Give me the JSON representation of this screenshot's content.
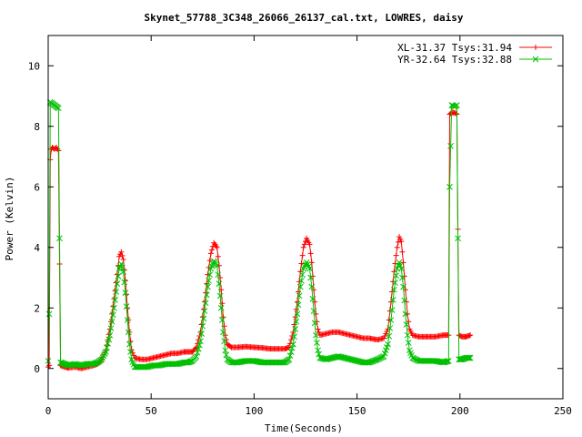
{
  "chart_data": {
    "type": "scatter",
    "title": "Skynet_57788_3C348_26066_26137_cal.txt, LOWRES, daisy",
    "xlabel": "Time(Seconds)",
    "ylabel": "Power (Kelvin)",
    "xlim": [
      0,
      250
    ],
    "ylim": [
      -1,
      11
    ],
    "x_ticks": [
      0,
      50,
      100,
      150,
      200,
      250
    ],
    "y_ticks": [
      0,
      2,
      4,
      6,
      8,
      10
    ],
    "grid": false,
    "legend_position": "top-right",
    "series": [
      {
        "name": "XL-31.37 Tsys:31.94",
        "color": "#ff0000",
        "marker": "plus",
        "points": [
          [
            0,
            0.05
          ],
          [
            0.5,
            0.1
          ],
          [
            1,
            6.9
          ],
          [
            1.5,
            7.25
          ],
          [
            2,
            7.3
          ],
          [
            3,
            7.25
          ],
          [
            4,
            7.3
          ],
          [
            5,
            7.2
          ],
          [
            5.5,
            3.45
          ],
          [
            6,
            0.1
          ],
          [
            8,
            0.05
          ],
          [
            10,
            0.02
          ],
          [
            13,
            0.05
          ],
          [
            16,
            0.0
          ],
          [
            19,
            0.05
          ],
          [
            22,
            0.1
          ],
          [
            24,
            0.15
          ],
          [
            26,
            0.3
          ],
          [
            28,
            0.6
          ],
          [
            30,
            1.3
          ],
          [
            32,
            2.3
          ],
          [
            33.5,
            3.1
          ],
          [
            34.5,
            3.7
          ],
          [
            35.5,
            3.85
          ],
          [
            36.5,
            3.6
          ],
          [
            37.5,
            2.9
          ],
          [
            38.5,
            2.0
          ],
          [
            39.5,
            1.2
          ],
          [
            40.5,
            0.6
          ],
          [
            42,
            0.35
          ],
          [
            45,
            0.3
          ],
          [
            48,
            0.3
          ],
          [
            51,
            0.35
          ],
          [
            54,
            0.4
          ],
          [
            57,
            0.45
          ],
          [
            60,
            0.5
          ],
          [
            63,
            0.5
          ],
          [
            66,
            0.55
          ],
          [
            68,
            0.55
          ],
          [
            70,
            0.55
          ],
          [
            72,
            0.7
          ],
          [
            74,
            1.2
          ],
          [
            76,
            2.2
          ],
          [
            77.5,
            3.1
          ],
          [
            79,
            3.8
          ],
          [
            80.5,
            4.15
          ],
          [
            82,
            4.0
          ],
          [
            83,
            3.4
          ],
          [
            84,
            2.6
          ],
          [
            85,
            1.7
          ],
          [
            86,
            1.1
          ],
          [
            87,
            0.8
          ],
          [
            89,
            0.7
          ],
          [
            92,
            0.7
          ],
          [
            96,
            0.72
          ],
          [
            100,
            0.7
          ],
          [
            104,
            0.68
          ],
          [
            108,
            0.65
          ],
          [
            112,
            0.65
          ],
          [
            115,
            0.65
          ],
          [
            117,
            0.7
          ],
          [
            119,
            1.2
          ],
          [
            121,
            2.2
          ],
          [
            122.5,
            3.2
          ],
          [
            124,
            4.0
          ],
          [
            125.5,
            4.3
          ],
          [
            127,
            4.1
          ],
          [
            128,
            3.5
          ],
          [
            129,
            2.6
          ],
          [
            130,
            1.8
          ],
          [
            131,
            1.3
          ],
          [
            132,
            1.1
          ],
          [
            135,
            1.15
          ],
          [
            138,
            1.2
          ],
          [
            141,
            1.2
          ],
          [
            144,
            1.15
          ],
          [
            147,
            1.1
          ],
          [
            150,
            1.05
          ],
          [
            153,
            1.0
          ],
          [
            156,
            1.0
          ],
          [
            160,
            0.95
          ],
          [
            163,
            1.0
          ],
          [
            165,
            1.3
          ],
          [
            166.5,
            2.2
          ],
          [
            168,
            3.2
          ],
          [
            169.5,
            4.0
          ],
          [
            170.5,
            4.35
          ],
          [
            171.5,
            4.2
          ],
          [
            172.5,
            3.5
          ],
          [
            173.5,
            2.6
          ],
          [
            174.5,
            1.8
          ],
          [
            175.5,
            1.3
          ],
          [
            177,
            1.1
          ],
          [
            180,
            1.05
          ],
          [
            184,
            1.05
          ],
          [
            188,
            1.05
          ],
          [
            192,
            1.1
          ],
          [
            194.5,
            1.1
          ],
          [
            195,
            8.4
          ],
          [
            196,
            8.45
          ],
          [
            197.5,
            8.45
          ],
          [
            198.5,
            8.4
          ],
          [
            199,
            4.6
          ],
          [
            199.5,
            1.1
          ],
          [
            201,
            1.05
          ],
          [
            203,
            1.05
          ],
          [
            205,
            1.1
          ]
        ]
      },
      {
        "name": "YR-32.64 Tsys:32.88",
        "color": "#00c000",
        "marker": "cross",
        "points": [
          [
            0,
            0.25
          ],
          [
            0.5,
            1.8
          ],
          [
            1,
            8.8
          ],
          [
            2,
            8.75
          ],
          [
            3,
            8.7
          ],
          [
            4,
            8.65
          ],
          [
            5,
            8.6
          ],
          [
            5.5,
            4.3
          ],
          [
            6,
            0.2
          ],
          [
            8,
            0.15
          ],
          [
            10,
            0.1
          ],
          [
            13,
            0.15
          ],
          [
            16,
            0.1
          ],
          [
            19,
            0.15
          ],
          [
            22,
            0.15
          ],
          [
            24,
            0.2
          ],
          [
            26,
            0.3
          ],
          [
            28,
            0.55
          ],
          [
            30,
            1.1
          ],
          [
            32,
            2.0
          ],
          [
            33.5,
            2.8
          ],
          [
            34.5,
            3.3
          ],
          [
            35.5,
            3.45
          ],
          [
            36.5,
            3.2
          ],
          [
            37.5,
            2.5
          ],
          [
            38.5,
            1.6
          ],
          [
            39.5,
            0.8
          ],
          [
            40.5,
            0.3
          ],
          [
            42,
            0.05
          ],
          [
            45,
            0.05
          ],
          [
            48,
            0.05
          ],
          [
            51,
            0.1
          ],
          [
            54,
            0.1
          ],
          [
            57,
            0.15
          ],
          [
            60,
            0.15
          ],
          [
            63,
            0.15
          ],
          [
            66,
            0.2
          ],
          [
            68,
            0.2
          ],
          [
            70,
            0.25
          ],
          [
            72,
            0.4
          ],
          [
            74,
            0.9
          ],
          [
            76,
            1.9
          ],
          [
            77.5,
            2.7
          ],
          [
            79,
            3.3
          ],
          [
            80.5,
            3.55
          ],
          [
            82,
            3.4
          ],
          [
            83,
            2.8
          ],
          [
            84,
            2.0
          ],
          [
            85,
            1.2
          ],
          [
            86,
            0.6
          ],
          [
            87,
            0.3
          ],
          [
            89,
            0.2
          ],
          [
            92,
            0.2
          ],
          [
            96,
            0.25
          ],
          [
            100,
            0.25
          ],
          [
            104,
            0.2
          ],
          [
            108,
            0.2
          ],
          [
            112,
            0.2
          ],
          [
            115,
            0.2
          ],
          [
            117,
            0.3
          ],
          [
            119,
            0.8
          ],
          [
            121,
            1.8
          ],
          [
            122.5,
            2.7
          ],
          [
            124,
            3.3
          ],
          [
            125.5,
            3.5
          ],
          [
            127,
            3.3
          ],
          [
            128,
            2.7
          ],
          [
            129,
            1.9
          ],
          [
            130,
            1.1
          ],
          [
            131,
            0.6
          ],
          [
            132,
            0.35
          ],
          [
            135,
            0.3
          ],
          [
            138,
            0.35
          ],
          [
            141,
            0.4
          ],
          [
            144,
            0.35
          ],
          [
            147,
            0.3
          ],
          [
            150,
            0.25
          ],
          [
            153,
            0.2
          ],
          [
            156,
            0.2
          ],
          [
            160,
            0.3
          ],
          [
            163,
            0.4
          ],
          [
            165,
            0.8
          ],
          [
            166.5,
            1.6
          ],
          [
            168,
            2.6
          ],
          [
            169.5,
            3.3
          ],
          [
            170.5,
            3.5
          ],
          [
            171.5,
            3.3
          ],
          [
            172.5,
            2.7
          ],
          [
            173.5,
            1.8
          ],
          [
            174.5,
            1.1
          ],
          [
            175.5,
            0.6
          ],
          [
            177,
            0.35
          ],
          [
            180,
            0.25
          ],
          [
            184,
            0.25
          ],
          [
            188,
            0.25
          ],
          [
            192,
            0.2
          ],
          [
            194.5,
            0.25
          ],
          [
            195,
            6.0
          ],
          [
            196,
            8.7
          ],
          [
            197.5,
            8.65
          ],
          [
            198.5,
            8.7
          ],
          [
            199,
            4.3
          ],
          [
            199.5,
            0.3
          ],
          [
            201,
            0.3
          ],
          [
            203,
            0.35
          ],
          [
            205,
            0.35
          ]
        ]
      }
    ]
  }
}
